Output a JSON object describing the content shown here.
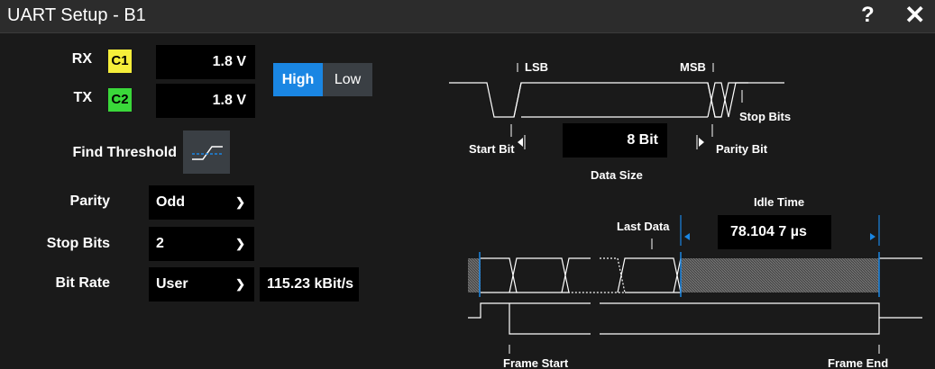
{
  "dialog": {
    "title": "UART Setup - B1",
    "help_icon": "?",
    "close_icon": "✕"
  },
  "rx": {
    "label": "RX",
    "channel": "C1",
    "channel_color": "#f5ee3a",
    "threshold": "1.8 V"
  },
  "tx": {
    "label": "TX",
    "channel": "C2",
    "channel_color": "#3ad83a",
    "threshold": "1.8 V"
  },
  "polarity": {
    "high": "High",
    "low": "Low",
    "active_color": "#1a86e3",
    "inactive_color": "#3a3f44",
    "selected": "High"
  },
  "find_threshold": {
    "label": "Find Threshold",
    "icon": "threshold-icon"
  },
  "parity": {
    "label": "Parity",
    "value": "Odd"
  },
  "stop_bits": {
    "label": "Stop Bits",
    "value": "2"
  },
  "bit_rate": {
    "label": "Bit Rate",
    "value": "User",
    "rate": "115.23 kBit/s"
  },
  "frame_diagram": {
    "lsb": "LSB",
    "msb": "MSB",
    "stop_bits": "Stop Bits",
    "start_bit": "Start Bit",
    "parity_bit": "Parity Bit",
    "data_size_value": "8 Bit",
    "data_size_label": "Data Size"
  },
  "idle_diagram": {
    "idle_time_label": "Idle Time",
    "last_data": "Last Data",
    "idle_time_value": "78.104 7 µs",
    "frame_start": "Frame Start",
    "frame_end": "Frame End",
    "marker_color": "#1a86e3"
  }
}
